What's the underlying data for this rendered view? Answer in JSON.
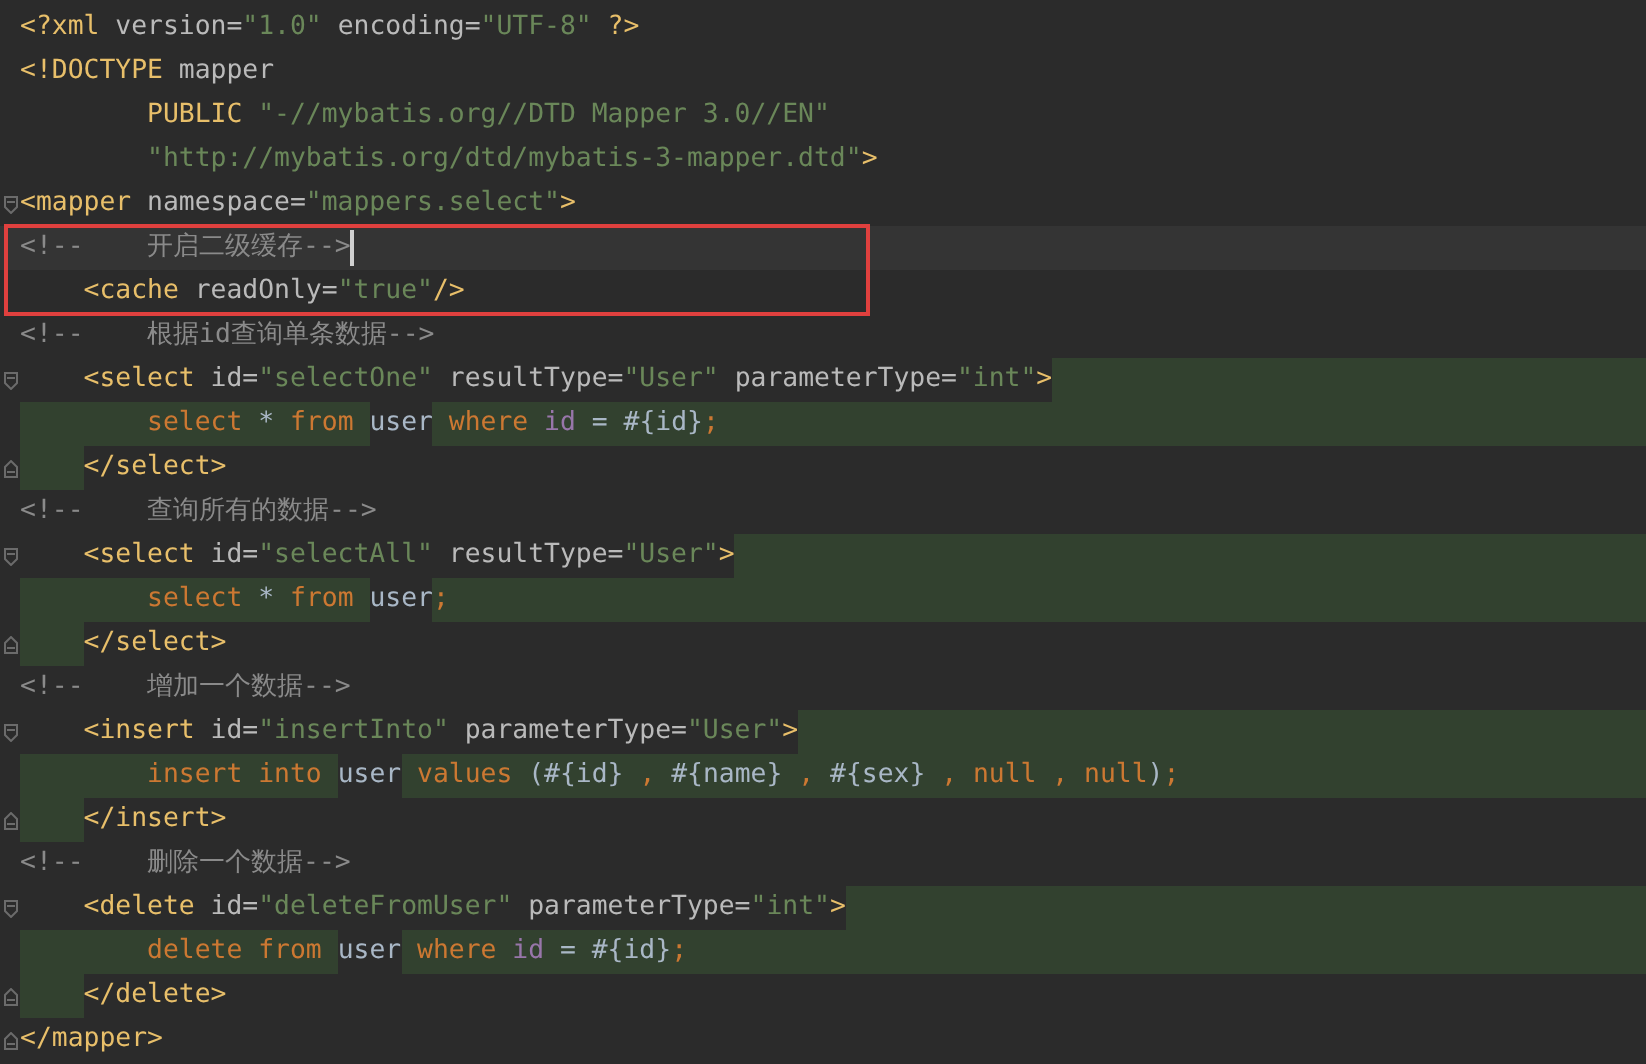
{
  "editor": {
    "lines": [
      {
        "segments": [
          {
            "text": "<?xml",
            "kind": "tag"
          },
          {
            "text": " version=",
            "kind": "attr"
          },
          {
            "text": "\"1.0\"",
            "kind": "value"
          },
          {
            "text": " encoding=",
            "kind": "attr"
          },
          {
            "text": "\"UTF-8\"",
            "kind": "value"
          },
          {
            "text": " ?>",
            "kind": "tag"
          }
        ]
      },
      {
        "segments": [
          {
            "text": "<!DOCTYPE",
            "kind": "tag"
          },
          {
            "text": " mapper",
            "kind": "attr"
          }
        ]
      },
      {
        "segments": [
          {
            "text": "        PUBLIC",
            "kind": "tag"
          },
          {
            "text": " \"-//mybatis.org//DTD Mapper 3.0//EN\"",
            "kind": "value"
          }
        ]
      },
      {
        "segments": [
          {
            "text": "        \"http://mybatis.org/dtd/mybatis-3-mapper.dtd\"",
            "kind": "value"
          },
          {
            "text": ">",
            "kind": "tag"
          }
        ]
      },
      {
        "fold_open": true,
        "segments": [
          {
            "text": "<mapper",
            "kind": "tag"
          },
          {
            "text": " namespace=",
            "kind": "attr"
          },
          {
            "text": "\"mappers.select\"",
            "kind": "value"
          },
          {
            "text": ">",
            "kind": "tag"
          }
        ]
      },
      {
        "current": true,
        "boxed": true,
        "segments": [
          {
            "text": "<!--    开启二级缓存-->",
            "kind": "comment"
          }
        ]
      },
      {
        "boxed": true,
        "segments": [
          {
            "text": "    <cache",
            "kind": "tag"
          },
          {
            "text": " readOnly=",
            "kind": "attr"
          },
          {
            "text": "\"true\"",
            "kind": "value"
          },
          {
            "text": "/>",
            "kind": "tag"
          }
        ]
      },
      {
        "segments": [
          {
            "text": "<!--    根据id查询单条数据-->",
            "kind": "comment"
          }
        ]
      },
      {
        "fold_open": true,
        "shade_rest": true,
        "segments": [
          {
            "text": "    <select",
            "kind": "tag",
            "shaded": false
          },
          {
            "text": " id=",
            "kind": "attr",
            "shaded": false
          },
          {
            "text": "\"selectOne\"",
            "kind": "value",
            "shaded": false
          },
          {
            "text": " resultType=",
            "kind": "attr",
            "shaded": false
          },
          {
            "text": "\"User\"",
            "kind": "value",
            "shaded": false
          },
          {
            "text": " parameterType=",
            "kind": "attr",
            "shaded": false
          },
          {
            "text": "\"int\"",
            "kind": "value",
            "shaded": false
          },
          {
            "text": ">",
            "kind": "tag",
            "shaded": false
          }
        ]
      },
      {
        "shade_rest": true,
        "segments": [
          {
            "text": "        select",
            "kind": "keyword",
            "shaded": true
          },
          {
            "text": " * ",
            "kind": "plain",
            "shaded": true
          },
          {
            "text": "from ",
            "kind": "keyword",
            "shaded": true
          },
          {
            "text": "user",
            "kind": "plain",
            "shaded": false
          },
          {
            "text": " where ",
            "kind": "keyword",
            "shaded": true
          },
          {
            "text": "id",
            "kind": "field",
            "shaded": true
          },
          {
            "text": " = #{id}",
            "kind": "plain",
            "shaded": true
          },
          {
            "text": ";",
            "kind": "keyword",
            "shaded": true
          }
        ]
      },
      {
        "fold_close": true,
        "shade_lead": true,
        "segments": [
          {
            "text": "    </select>",
            "kind": "tag",
            "shaded": false
          }
        ]
      },
      {
        "segments": [
          {
            "text": "<!--    查询所有的数据-->",
            "kind": "comment"
          }
        ]
      },
      {
        "fold_open": true,
        "shade_rest": true,
        "segments": [
          {
            "text": "    <select",
            "kind": "tag",
            "shaded": false
          },
          {
            "text": " id=",
            "kind": "attr",
            "shaded": false
          },
          {
            "text": "\"selectAll\"",
            "kind": "value",
            "shaded": false
          },
          {
            "text": " resultType=",
            "kind": "attr",
            "shaded": false
          },
          {
            "text": "\"User\"",
            "kind": "value",
            "shaded": false
          },
          {
            "text": ">",
            "kind": "tag",
            "shaded": false
          }
        ]
      },
      {
        "shade_rest": true,
        "segments": [
          {
            "text": "        select",
            "kind": "keyword",
            "shaded": true
          },
          {
            "text": " * ",
            "kind": "plain",
            "shaded": true
          },
          {
            "text": "from ",
            "kind": "keyword",
            "shaded": true
          },
          {
            "text": "user",
            "kind": "plain",
            "shaded": false
          },
          {
            "text": ";",
            "kind": "keyword",
            "shaded": true
          }
        ]
      },
      {
        "fold_close": true,
        "shade_lead": true,
        "segments": [
          {
            "text": "    </select>",
            "kind": "tag",
            "shaded": false
          }
        ]
      },
      {
        "segments": [
          {
            "text": "<!--    增加一个数据-->",
            "kind": "comment"
          }
        ]
      },
      {
        "fold_open": true,
        "shade_rest": true,
        "segments": [
          {
            "text": "    <insert",
            "kind": "tag",
            "shaded": false
          },
          {
            "text": " id=",
            "kind": "attr",
            "shaded": false
          },
          {
            "text": "\"insertInto\"",
            "kind": "value",
            "shaded": false
          },
          {
            "text": " parameterType=",
            "kind": "attr",
            "shaded": false
          },
          {
            "text": "\"User\"",
            "kind": "value",
            "shaded": false
          },
          {
            "text": ">",
            "kind": "tag",
            "shaded": false
          }
        ]
      },
      {
        "shade_rest": true,
        "segments": [
          {
            "text": "        insert into ",
            "kind": "keyword",
            "shaded": true
          },
          {
            "text": "user",
            "kind": "plain",
            "shaded": false
          },
          {
            "text": " values ",
            "kind": "keyword",
            "shaded": true
          },
          {
            "text": "(#{id} ",
            "kind": "plain",
            "shaded": true
          },
          {
            "text": ", ",
            "kind": "keyword",
            "shaded": true
          },
          {
            "text": "#{name} ",
            "kind": "plain",
            "shaded": true
          },
          {
            "text": ", ",
            "kind": "keyword",
            "shaded": true
          },
          {
            "text": "#{sex} ",
            "kind": "plain",
            "shaded": true
          },
          {
            "text": ", null , null",
            "kind": "keyword",
            "shaded": true
          },
          {
            "text": ")",
            "kind": "plain",
            "shaded": true
          },
          {
            "text": ";",
            "kind": "keyword",
            "shaded": true
          }
        ]
      },
      {
        "fold_close": true,
        "shade_lead": true,
        "segments": [
          {
            "text": "    </insert>",
            "kind": "tag",
            "shaded": false
          }
        ]
      },
      {
        "segments": [
          {
            "text": "<!--    删除一个数据-->",
            "kind": "comment"
          }
        ]
      },
      {
        "fold_open": true,
        "shade_rest": true,
        "segments": [
          {
            "text": "    <delete",
            "kind": "tag",
            "shaded": false
          },
          {
            "text": " id=",
            "kind": "attr",
            "shaded": false
          },
          {
            "text": "\"deleteFromUser\"",
            "kind": "value",
            "shaded": false
          },
          {
            "text": " parameterType=",
            "kind": "attr",
            "shaded": false
          },
          {
            "text": "\"int\"",
            "kind": "value",
            "shaded": false
          },
          {
            "text": ">",
            "kind": "tag",
            "shaded": false
          }
        ]
      },
      {
        "shade_rest": true,
        "segments": [
          {
            "text": "        delete from ",
            "kind": "keyword",
            "shaded": true
          },
          {
            "text": "user",
            "kind": "plain",
            "shaded": false
          },
          {
            "text": " where ",
            "kind": "keyword",
            "shaded": true
          },
          {
            "text": "id",
            "kind": "field",
            "shaded": true
          },
          {
            "text": " = #{id}",
            "kind": "plain",
            "shaded": true
          },
          {
            "text": ";",
            "kind": "keyword",
            "shaded": true
          }
        ]
      },
      {
        "fold_close": true,
        "shade_lead": true,
        "segments": [
          {
            "text": "    </delete>",
            "kind": "tag",
            "shaded": false
          }
        ]
      },
      {
        "fold_close": true,
        "segments": [
          {
            "text": "</mapper>",
            "kind": "tag"
          }
        ]
      }
    ]
  }
}
